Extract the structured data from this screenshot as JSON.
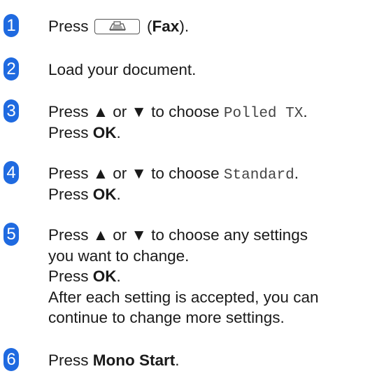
{
  "steps": [
    {
      "number": "1",
      "press": "Press",
      "fax_key_icon": "fax-icon",
      "fax_open": "(",
      "fax_label": "Fax",
      "fax_close": ")."
    },
    {
      "number": "2",
      "text": "Load your document."
    },
    {
      "number": "3",
      "prefix": "Press ▲ or ▼ to choose",
      "option": "Polled TX",
      "suffix": ".",
      "press_prefix": "Press",
      "press_key": "OK",
      "press_suffix": "."
    },
    {
      "number": "4",
      "prefix": "Press ▲ or ▼ to choose",
      "option": "Standard",
      "suffix": ".",
      "press_prefix": "Press",
      "press_key": "OK",
      "press_suffix": "."
    },
    {
      "number": "5",
      "line1": "Press ▲ or ▼ to choose any settings",
      "line2": "you want to change.",
      "press_prefix": "Press",
      "press_key": "OK",
      "press_suffix": ".",
      "line4": "After each setting is accepted, you can",
      "line5": "continue to change more settings."
    },
    {
      "number": "6",
      "press_prefix": "Press",
      "press_key": "Mono Start",
      "press_suffix": "."
    }
  ],
  "colors": {
    "step_badge": "#1f6ae0",
    "text": "#1a1a1a",
    "lcd_text": "#444444"
  }
}
